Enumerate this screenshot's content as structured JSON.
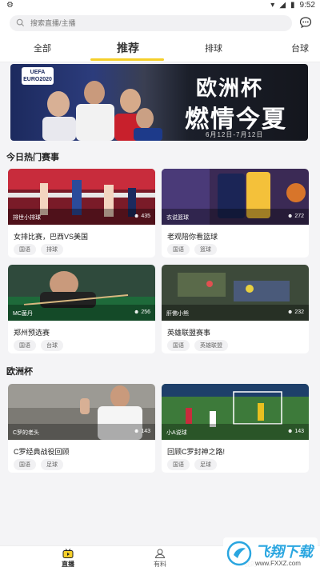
{
  "status_bar": {
    "time": "9:52"
  },
  "search": {
    "placeholder": "搜索直播/主播"
  },
  "tabs": [
    {
      "label": "全部"
    },
    {
      "label": "推荐"
    },
    {
      "label": "排球"
    },
    {
      "label": "台球"
    }
  ],
  "banner": {
    "badge_line1": "UEFA",
    "badge_line2": "EURO2020",
    "title_line1": "欧洲杯",
    "title_line2": "燃情今夏",
    "date": "6月12日-7月12日"
  },
  "sections": [
    {
      "title": "今日热门赛事",
      "cards": [
        {
          "host": "排世小排球",
          "viewers": "435",
          "title": "女排比赛，巴西VS美国",
          "tags": [
            "国语",
            "排球"
          ]
        },
        {
          "host": "衣说篮球",
          "viewers": "272",
          "title": "老观陪你看篮球",
          "tags": [
            "国语",
            "篮球"
          ]
        },
        {
          "host": "MC菌丹",
          "viewers": "256",
          "title": "郑州预选赛",
          "tags": [
            "国语",
            "台球"
          ]
        },
        {
          "host": "肝佛小熊",
          "viewers": "232",
          "title": "英雄联盟赛事",
          "tags": [
            "国语",
            "英雄联盟"
          ]
        }
      ]
    },
    {
      "title": "欧洲杯",
      "cards": [
        {
          "host": "C罗的老头",
          "viewers": "143",
          "title": "C罗经典战役回顾",
          "tags": [
            "国语",
            "足球"
          ]
        },
        {
          "host": "小A说球",
          "viewers": "143",
          "title": "回顾C罗封神之路!",
          "tags": [
            "国语",
            "足球"
          ]
        }
      ]
    }
  ],
  "bottom_nav": [
    {
      "label": "直播"
    },
    {
      "label": "有料"
    },
    {
      "label": "我的"
    }
  ],
  "watermark": {
    "brand": "飞翔下载",
    "url": "www.FXXZ.com"
  },
  "colors": {
    "accent": "#f5cf2a",
    "background": "#f4f4f6"
  }
}
